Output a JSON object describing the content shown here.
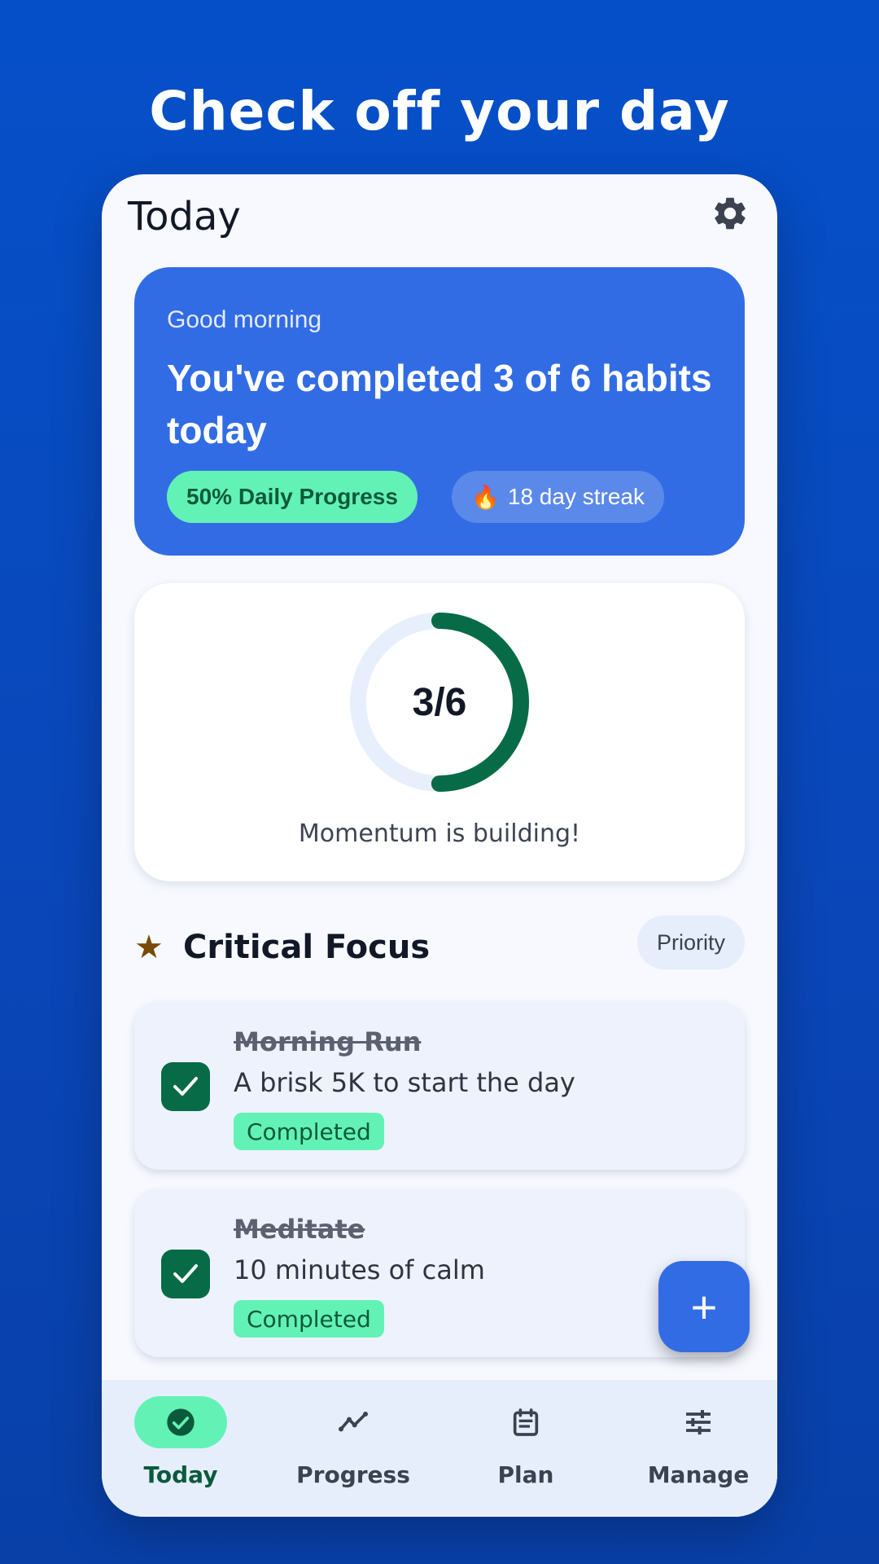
{
  "headline": "Check off your day",
  "app": {
    "title": "Today"
  },
  "hero": {
    "greeting": "Good morning",
    "message": "You've completed 3 of 6 habits today",
    "progress_chip": "50% Daily Progress",
    "streak_chip": "18 day streak",
    "streak_icon": "🔥"
  },
  "ring": {
    "completed": 3,
    "total": 6,
    "label": "3/6",
    "caption": "Momentum is building!",
    "track_color": "#e8effc",
    "fill_color": "#076b47"
  },
  "section": {
    "title": "Critical Focus",
    "pill": "Priority"
  },
  "habits": [
    {
      "name": "Morning Run",
      "description": "A brisk 5K to start the day",
      "status": "Completed"
    },
    {
      "name": "Meditate",
      "description": "10 minutes of calm",
      "status": "Completed"
    }
  ],
  "fab": {
    "label": "+"
  },
  "nav": [
    {
      "label": "Today",
      "icon": "check-circle-icon",
      "active": true
    },
    {
      "label": "Progress",
      "icon": "trend-line-icon",
      "active": false
    },
    {
      "label": "Plan",
      "icon": "calendar-icon",
      "active": false
    },
    {
      "label": "Manage",
      "icon": "sliders-icon",
      "active": false
    }
  ],
  "colors": {
    "background": "#0550c9",
    "accent": "#326ce5",
    "success": "#63f2b5",
    "success_dark": "#076b47"
  }
}
